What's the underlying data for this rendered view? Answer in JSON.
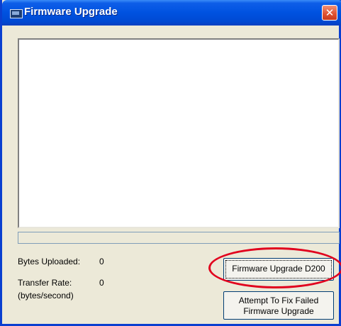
{
  "window": {
    "title": "Firmware Upgrade",
    "close_glyph": "✕"
  },
  "icons": {
    "app": "app-window-icon",
    "close": "close-icon"
  },
  "log": {
    "text": ""
  },
  "progress": {
    "fraction": 0.0
  },
  "stats": {
    "bytes_uploaded_label": "Bytes Uploaded:",
    "bytes_uploaded_value": "0",
    "transfer_rate_label": "Transfer Rate:",
    "transfer_rate_value": "0",
    "transfer_rate_unit": "(bytes/second)"
  },
  "buttons": {
    "upgrade_label": "Firmware Upgrade D200",
    "fix_line1": "Attempt To Fix Failed",
    "fix_line2": "Firmware Upgrade"
  },
  "colors": {
    "titlebar": "#0052e0",
    "annotation": "#e1001d",
    "close": "#e0512f"
  }
}
